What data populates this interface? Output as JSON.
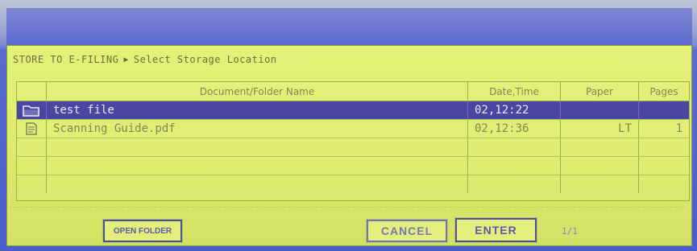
{
  "breadcrumb": {
    "root": "STORE TO E-FILING",
    "current": "Select Storage Location"
  },
  "table": {
    "headers": {
      "name": "Document/Folder Name",
      "date": "Date,Time",
      "paper": "Paper",
      "pages": "Pages"
    },
    "rows": [
      {
        "icon": "folder-icon",
        "name": "test file",
        "date": "02,12:22",
        "paper": "",
        "pages": "",
        "selected": true
      },
      {
        "icon": "document-icon",
        "name": "Scanning Guide.pdf",
        "date": "02,12:36",
        "paper": "LT",
        "pages": "1",
        "selected": false
      }
    ]
  },
  "buttons": {
    "open_folder": "OPEN FOLDER",
    "cancel": "CANCEL",
    "enter": "ENTER"
  },
  "pager": "1/1",
  "colors": {
    "screen_bg": "#dcea6c",
    "selection": "#4a47a0",
    "bezel": "#5a6bd0"
  }
}
